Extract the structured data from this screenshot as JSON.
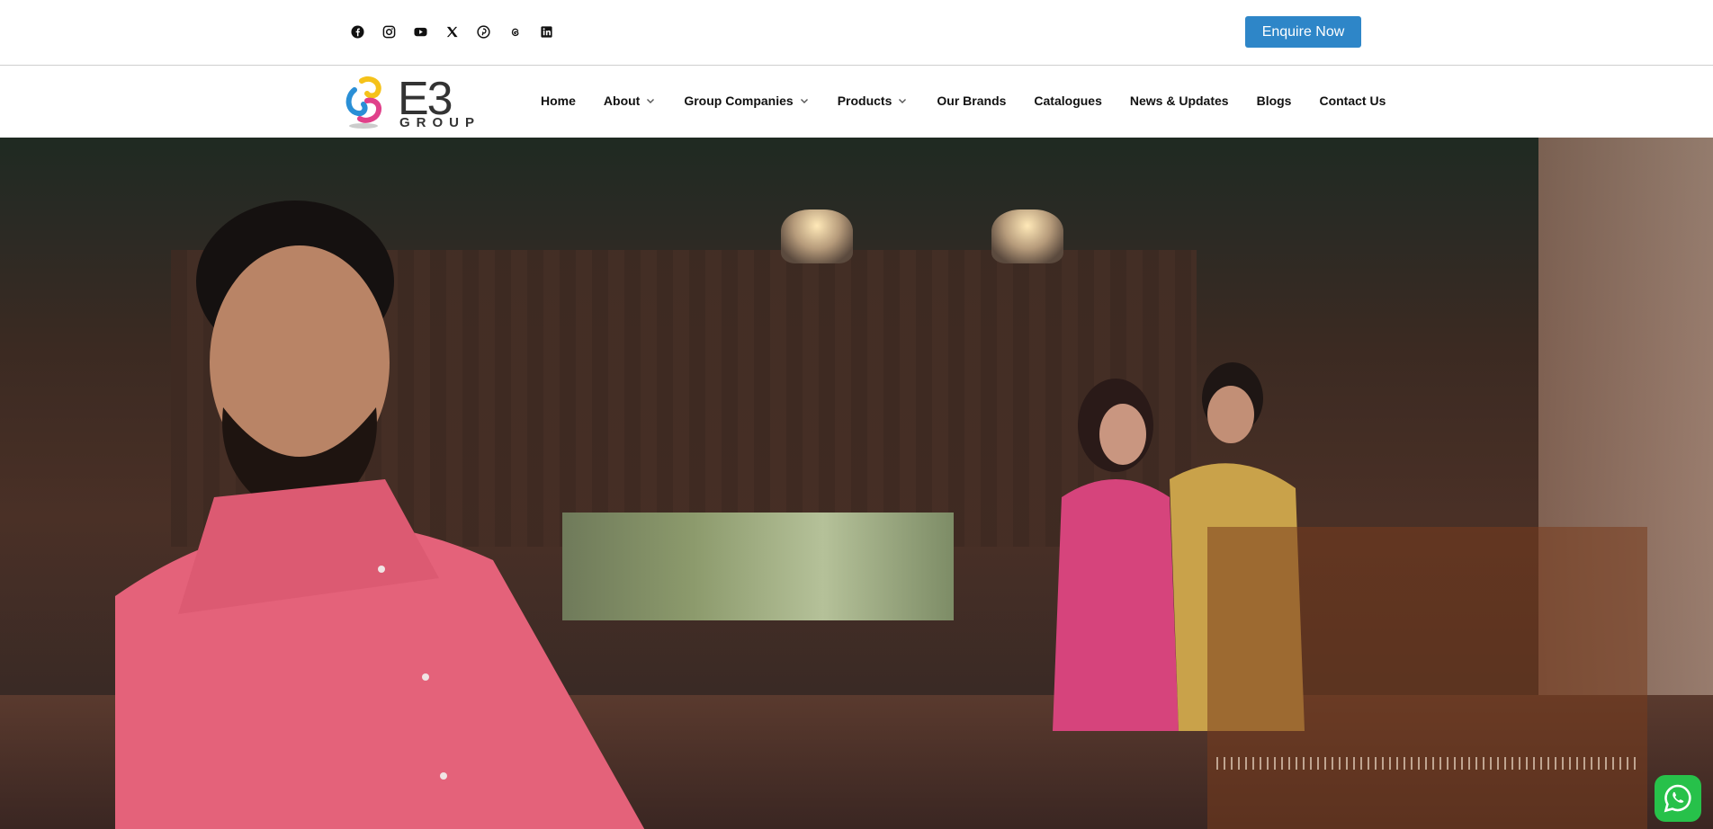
{
  "header": {
    "social_icons": [
      "facebook-icon",
      "instagram-icon",
      "youtube-icon",
      "x-twitter-icon",
      "pinterest-icon",
      "threads-icon",
      "linkedin-icon"
    ],
    "enquire_label": "Enquire Now"
  },
  "logo": {
    "mark": "E3",
    "sub": "GROUP"
  },
  "nav": {
    "items": [
      {
        "label": "Home",
        "dropdown": false
      },
      {
        "label": "About",
        "dropdown": true
      },
      {
        "label": "Group Companies",
        "dropdown": true
      },
      {
        "label": "Products",
        "dropdown": true
      },
      {
        "label": "Our Brands",
        "dropdown": false
      },
      {
        "label": "Catalogues",
        "dropdown": false
      },
      {
        "label": "News & Updates",
        "dropdown": false
      },
      {
        "label": "Blogs",
        "dropdown": false
      },
      {
        "label": "Contact Us",
        "dropdown": false
      }
    ]
  },
  "colors": {
    "accent": "#2e86c8",
    "whatsapp": "#27c14a"
  }
}
